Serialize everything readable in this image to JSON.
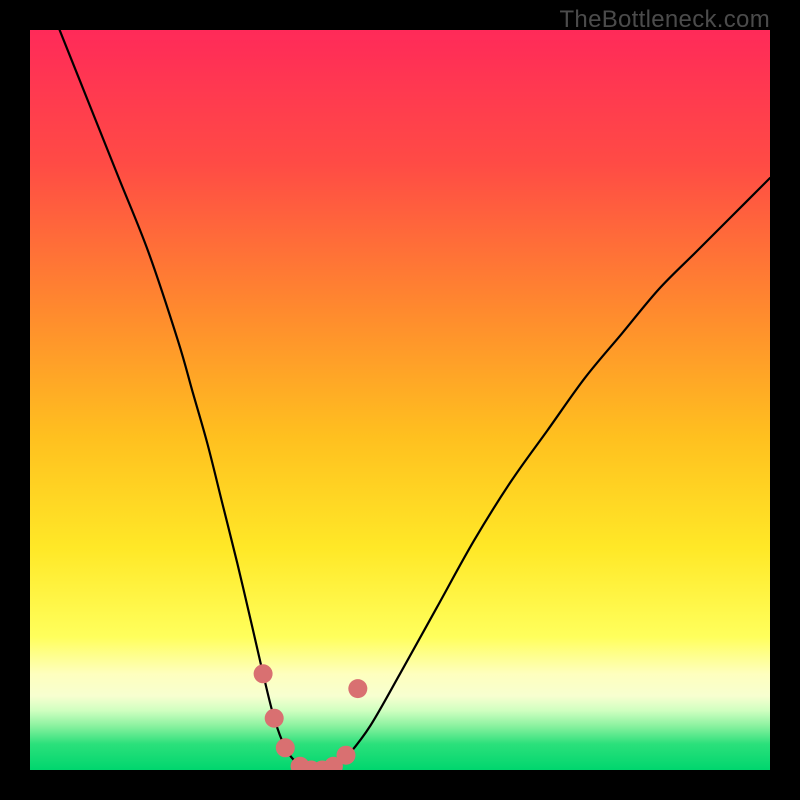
{
  "watermark": "TheBottleneck.com",
  "colors": {
    "top": "#FF2A59",
    "mid1": "#FF5B3A",
    "mid2": "#FFA524",
    "mid3": "#FFE827",
    "pale": "#FEFFBE",
    "green": "#18E06A",
    "green2": "#00D66E",
    "frame": "#000000",
    "curve": "#000000",
    "dot": "#D97071"
  },
  "chart_data": {
    "type": "line",
    "title": "",
    "xlabel": "",
    "ylabel": "",
    "xlim": [
      0,
      100
    ],
    "ylim": [
      0,
      100
    ],
    "series": [
      {
        "name": "left-curve",
        "x": [
          4,
          8,
          12,
          16,
          20,
          22,
          24,
          26,
          28,
          30,
          31.5,
          33,
          34.5,
          36,
          37.5
        ],
        "values": [
          100,
          90,
          80,
          70,
          58,
          51,
          44,
          36,
          28,
          19.5,
          13,
          7,
          3,
          1,
          0
        ]
      },
      {
        "name": "right-curve",
        "x": [
          41,
          43,
          46,
          50,
          55,
          60,
          65,
          70,
          75,
          80,
          85,
          90,
          95,
          100
        ],
        "values": [
          0,
          2,
          6,
          13,
          22,
          31,
          39,
          46,
          53,
          59,
          65,
          70,
          75,
          80
        ]
      },
      {
        "name": "valley-floor",
        "x": [
          37.5,
          38.5,
          39.5,
          40.5,
          41
        ],
        "values": [
          0,
          0,
          0,
          0,
          0
        ]
      }
    ],
    "scatter": [
      {
        "name": "dot",
        "x": 31.5,
        "y": 13
      },
      {
        "name": "dot",
        "x": 33,
        "y": 7
      },
      {
        "name": "dot",
        "x": 34.5,
        "y": 3
      },
      {
        "name": "dot",
        "x": 36.5,
        "y": 0.5
      },
      {
        "name": "dot",
        "x": 38,
        "y": 0
      },
      {
        "name": "dot",
        "x": 39.5,
        "y": 0
      },
      {
        "name": "dot",
        "x": 41,
        "y": 0.5
      },
      {
        "name": "dot",
        "x": 42.7,
        "y": 2
      },
      {
        "name": "dot",
        "x": 44.3,
        "y": 11
      }
    ]
  }
}
